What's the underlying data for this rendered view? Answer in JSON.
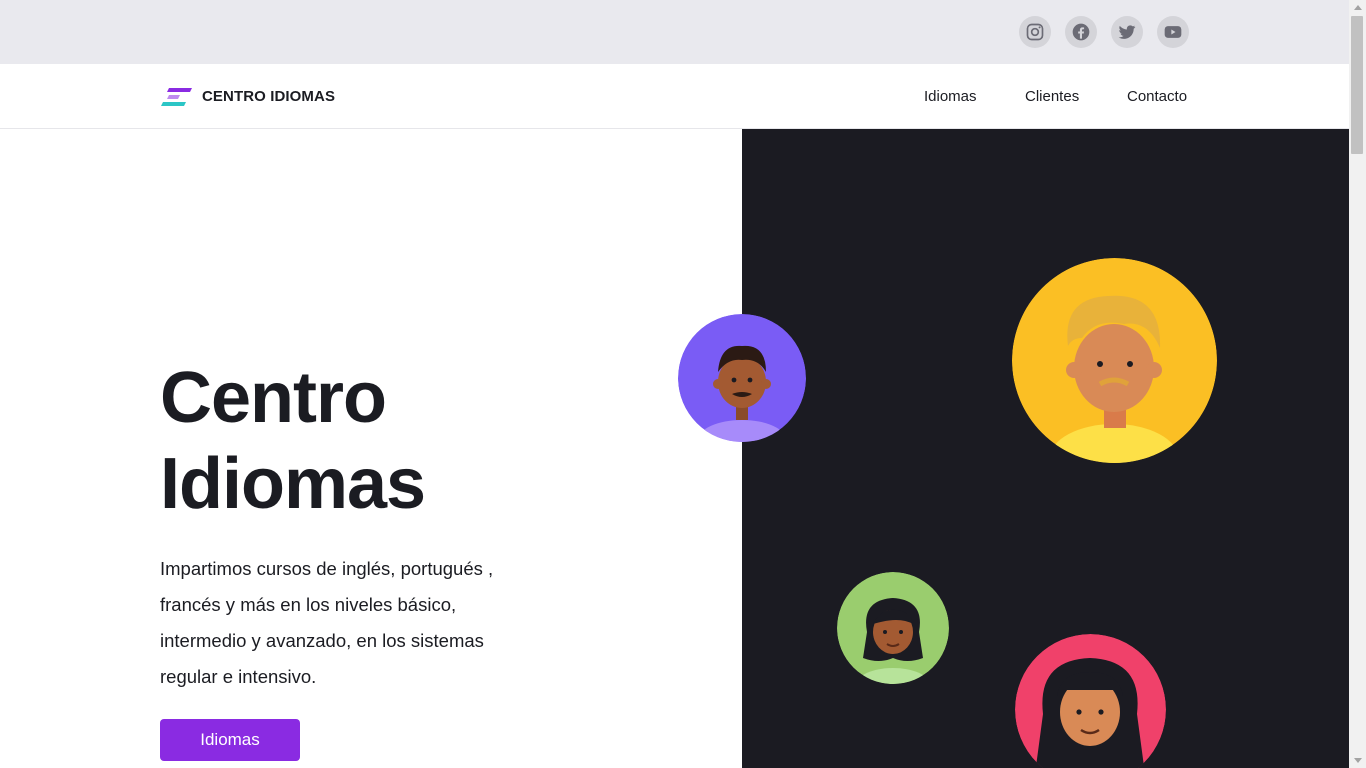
{
  "topbar": {
    "social": [
      {
        "name": "instagram-icon"
      },
      {
        "name": "facebook-icon"
      },
      {
        "name": "twitter-icon"
      },
      {
        "name": "youtube-icon"
      }
    ]
  },
  "nav": {
    "brand": "CENTRO IDIOMAS",
    "links": [
      "Idiomas",
      "Clientes",
      "Contacto"
    ]
  },
  "hero": {
    "title_line1": "Centro",
    "title_line2": "Idiomas",
    "description": "Impartimos cursos de inglés, portugués , francés y más en los niveles básico, intermedio y avanzado, en los sistemas regular e intensivo.",
    "cta_label": "Idiomas"
  },
  "colors": {
    "accent": "#8a2be2",
    "dark_panel": "#1b1b22",
    "topbar": "#e9e9ee"
  }
}
